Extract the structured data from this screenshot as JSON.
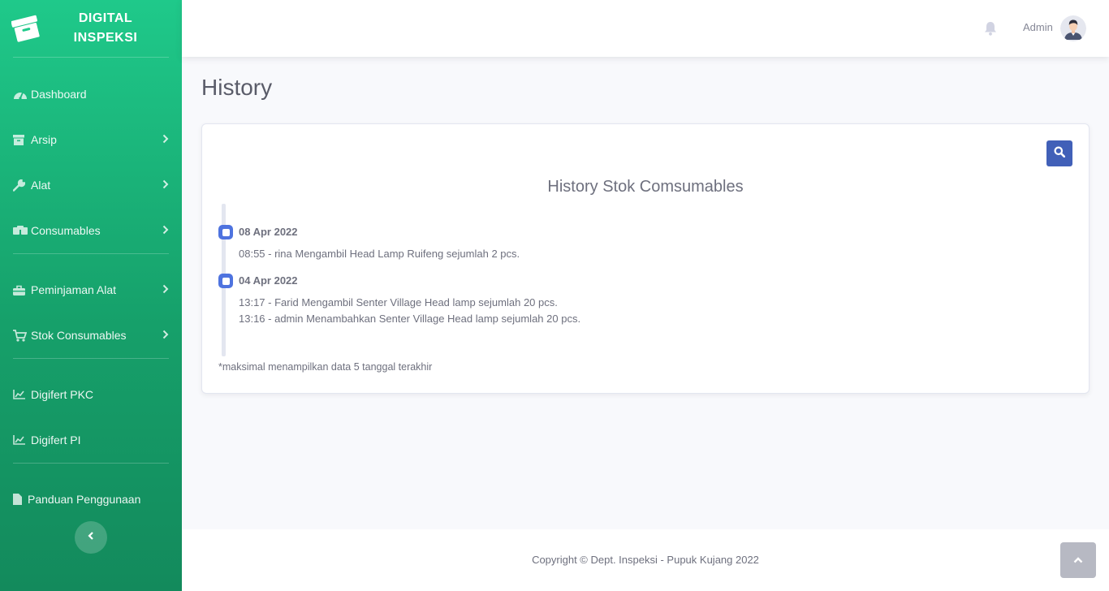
{
  "brand": {
    "line1": "DIGITAL",
    "line2": "INSPEKSI"
  },
  "sidebar": {
    "items": [
      {
        "label": "Dashboard",
        "icon": "tachometer-icon"
      },
      {
        "label": "Arsip",
        "icon": "archive-icon"
      },
      {
        "label": "Alat",
        "icon": "wrench-icon"
      },
      {
        "label": "Consumables",
        "icon": "boxes-icon"
      },
      {
        "label": "Peminjaman Alat",
        "icon": "toolbox-icon"
      },
      {
        "label": "Stok Consumables",
        "icon": "cart-icon"
      },
      {
        "label": "Digifert PKC",
        "icon": "chart-line-icon"
      },
      {
        "label": "Digifert PI",
        "icon": "chart-line-icon"
      },
      {
        "label": "Panduan Penggunaan",
        "icon": "file-icon"
      }
    ]
  },
  "topbar": {
    "user_name": "Admin"
  },
  "page": {
    "title": "History"
  },
  "card": {
    "title": "History Stok Comsumables",
    "timeline": [
      {
        "date": "08 Apr 2022",
        "entries": [
          "08:55 - rina Mengambil Head Lamp Ruifeng sejumlah 2 pcs."
        ]
      },
      {
        "date": "04 Apr 2022",
        "entries": [
          "13:17 - Farid Mengambil Senter Village Head lamp sejumlah 20 pcs.",
          "13:16 - admin Menambahkan Senter Village Head lamp sejumlah 20 pcs."
        ]
      }
    ],
    "note": "*maksimal menampilkan data 5 tanggal terakhir"
  },
  "footer": {
    "copyright": "Copyright © Dept. Inspeksi - Pupuk Kujang 2022"
  },
  "colors": {
    "sidebar_top": "#1fc98a",
    "sidebar_bottom": "#138a5c",
    "primary": "#4e73df",
    "search_button": "#4160b8"
  }
}
